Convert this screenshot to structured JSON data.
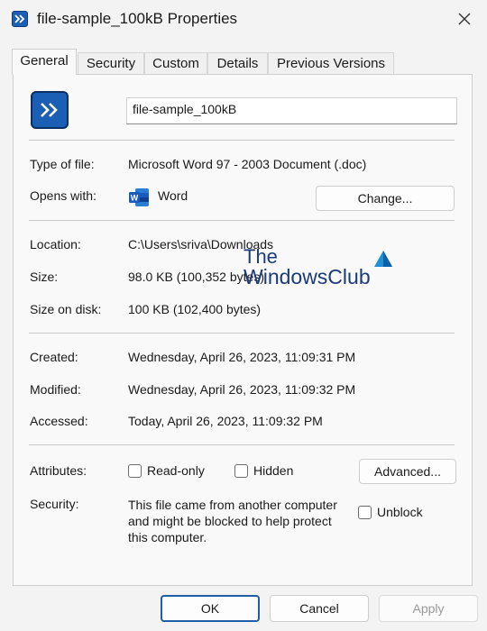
{
  "window": {
    "title": "file-sample_100kB Properties"
  },
  "tabs": [
    {
      "label": "General"
    },
    {
      "label": "Security"
    },
    {
      "label": "Custom"
    },
    {
      "label": "Details"
    },
    {
      "label": "Previous Versions"
    }
  ],
  "general": {
    "file_name": "file-sample_100kB",
    "type_label": "Type of file:",
    "type_value": "Microsoft Word 97 - 2003 Document (.doc)",
    "opens_label": "Opens with:",
    "opens_value": "Word",
    "change_label": "Change...",
    "location_label": "Location:",
    "location_value": "C:\\Users\\sriva\\Downloads",
    "size_label": "Size:",
    "size_value": "98.0 KB (100,352 bytes)",
    "disk_label": "Size on disk:",
    "disk_value": "100 KB (102,400 bytes)",
    "created_label": "Created:",
    "created_value": "Wednesday, April 26, 2023, 11:09:31 PM",
    "modified_label": "Modified:",
    "modified_value": "Wednesday, April 26, 2023, 11:09:32 PM",
    "accessed_label": "Accessed:",
    "accessed_value": "Today, April 26, 2023, 11:09:32 PM",
    "attributes_label": "Attributes:",
    "readonly_label": "Read-only",
    "hidden_label": "Hidden",
    "advanced_label": "Advanced...",
    "security_label": "Security:",
    "security_line1": "This file came from another computer",
    "security_line2": "and might be blocked to help protect",
    "security_line3": "this computer.",
    "unblock_label": "Unblock"
  },
  "buttons": {
    "ok": "OK",
    "cancel": "Cancel",
    "apply": "Apply"
  },
  "watermark": {
    "line1": "The",
    "line2": "WindowsClub"
  },
  "colors": {
    "accent": "#1a5fb4",
    "panel": "#f9f9f9",
    "window": "#f3f3f3"
  },
  "icons": [
    "app-icon",
    "close-icon",
    "word-icon",
    "windowsclub-logo"
  ]
}
